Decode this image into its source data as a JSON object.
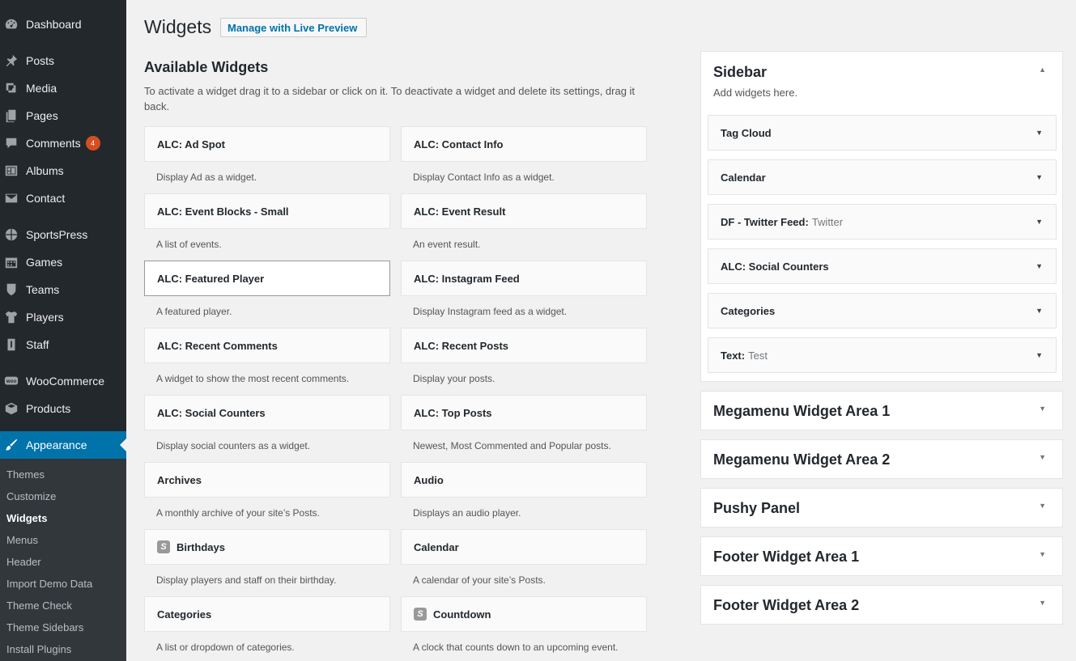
{
  "menu": {
    "items": [
      {
        "label": "Dashboard",
        "icon": "dashboard-icon"
      },
      {
        "label": "Posts",
        "icon": "pin-icon"
      },
      {
        "label": "Media",
        "icon": "media-icon"
      },
      {
        "label": "Pages",
        "icon": "pages-icon"
      },
      {
        "label": "Comments",
        "icon": "comment-icon",
        "badge": "4"
      },
      {
        "label": "Albums",
        "icon": "albums-icon"
      },
      {
        "label": "Contact",
        "icon": "mail-icon"
      },
      {
        "label": "SportsPress",
        "icon": "sportspress-icon"
      },
      {
        "label": "Games",
        "icon": "calendar-icon"
      },
      {
        "label": "Teams",
        "icon": "shield-icon"
      },
      {
        "label": "Players",
        "icon": "shirt-icon"
      },
      {
        "label": "Staff",
        "icon": "staff-icon"
      },
      {
        "label": "WooCommerce",
        "icon": "woocommerce-icon"
      },
      {
        "label": "Products",
        "icon": "box-icon"
      },
      {
        "label": "Appearance",
        "icon": "brush-icon"
      }
    ],
    "submenu": [
      "Themes",
      "Customize",
      "Widgets",
      "Menus",
      "Header",
      "Import Demo Data",
      "Theme Check",
      "Theme Sidebars",
      "Install Plugins"
    ]
  },
  "header": {
    "title": "Widgets",
    "live_preview_label": "Manage with Live Preview"
  },
  "available": {
    "title": "Available Widgets",
    "description": "To activate a widget drag it to a sidebar or click on it. To deactivate a widget and delete its settings, drag it back.",
    "widgets": [
      {
        "name": "ALC: Ad Spot",
        "desc": "Display Ad as a widget."
      },
      {
        "name": "ALC: Contact Info",
        "desc": "Display Contact Info as a widget."
      },
      {
        "name": "ALC: Event Blocks - Small",
        "desc": "A list of events."
      },
      {
        "name": "ALC: Event Result",
        "desc": "An event result."
      },
      {
        "name": "ALC: Featured Player",
        "desc": "A featured player."
      },
      {
        "name": "ALC: Instagram Feed",
        "desc": "Display Instagram feed as a widget."
      },
      {
        "name": "ALC: Recent Comments",
        "desc": "A widget to show the most recent comments."
      },
      {
        "name": "ALC: Recent Posts",
        "desc": "Display your posts."
      },
      {
        "name": "ALC: Social Counters",
        "desc": "Display social counters as a widget."
      },
      {
        "name": "ALC: Top Posts",
        "desc": "Newest, Most Commented and Popular posts."
      },
      {
        "name": "Archives",
        "desc": "A monthly archive of your site’s Posts."
      },
      {
        "name": "Audio",
        "desc": "Displays an audio player."
      },
      {
        "name": "Birthdays",
        "desc": "Display players and staff on their birthday."
      },
      {
        "name": "Calendar",
        "desc": "A calendar of your site’s Posts."
      },
      {
        "name": "Categories",
        "desc": "A list or dropdown of categories."
      },
      {
        "name": "Countdown",
        "desc": "A clock that counts down to an upcoming event."
      }
    ]
  },
  "sidebars": {
    "sidebar": {
      "title": "Sidebar",
      "desc": "Add widgets here.",
      "widgets": [
        {
          "name": "Tag Cloud",
          "sub": ""
        },
        {
          "name": "Calendar",
          "sub": ""
        },
        {
          "name": "DF - Twitter Feed:",
          "sub": "Twitter"
        },
        {
          "name": "ALC: Social Counters",
          "sub": ""
        },
        {
          "name": "Categories",
          "sub": ""
        },
        {
          "name": "Text:",
          "sub": "Test"
        }
      ]
    },
    "areas": [
      "Megamenu Widget Area 1",
      "Megamenu Widget Area 2",
      "Pushy Panel",
      "Footer Widget Area 1",
      "Footer Widget Area 2"
    ]
  }
}
